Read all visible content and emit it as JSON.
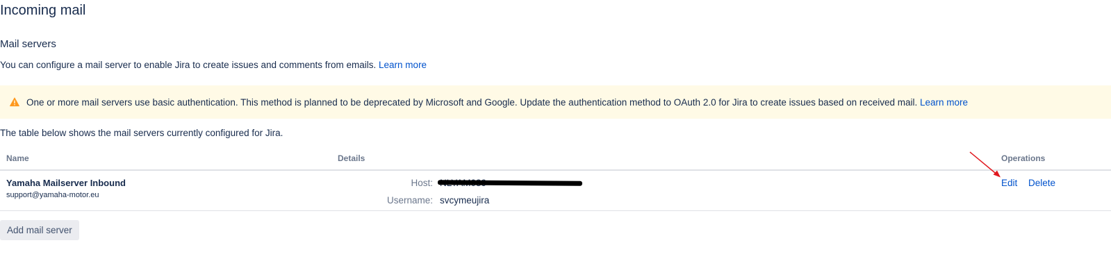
{
  "page": {
    "title": "Incoming mail"
  },
  "mail_servers": {
    "section_title": "Mail servers",
    "intro_text": "You can configure a mail server to enable Jira to create issues and comments from emails.",
    "intro_link": "Learn more",
    "warning": {
      "icon": "warning-icon",
      "text": "One or more mail servers use basic authentication. This method is planned to be deprecated by Microsoft and Google. Update the authentication method to OAuth 2.0 for Jira to create issues based on received mail.",
      "link": "Learn more",
      "background_color": "#fffae6",
      "icon_color": "#ff991f"
    },
    "table_intro": "The table below shows the mail servers currently configured for Jira.",
    "table": {
      "columns": [
        "Name",
        "Details",
        "Operations"
      ],
      "rows": [
        {
          "name": "Yamaha Mailserver Inbound",
          "email": "support@yamaha-motor.eu",
          "host_label": "Host:",
          "host_value": "NLYAM039",
          "username_label": "Username:",
          "username_value": "svcymeujira",
          "edit_label": "Edit",
          "delete_label": "Delete"
        }
      ]
    },
    "add_button_label": "Add mail server"
  },
  "colors": {
    "link": "#0052cc",
    "text": "#172b4d",
    "muted": "#6b778c",
    "annotation_arrow": "#e0191f"
  }
}
